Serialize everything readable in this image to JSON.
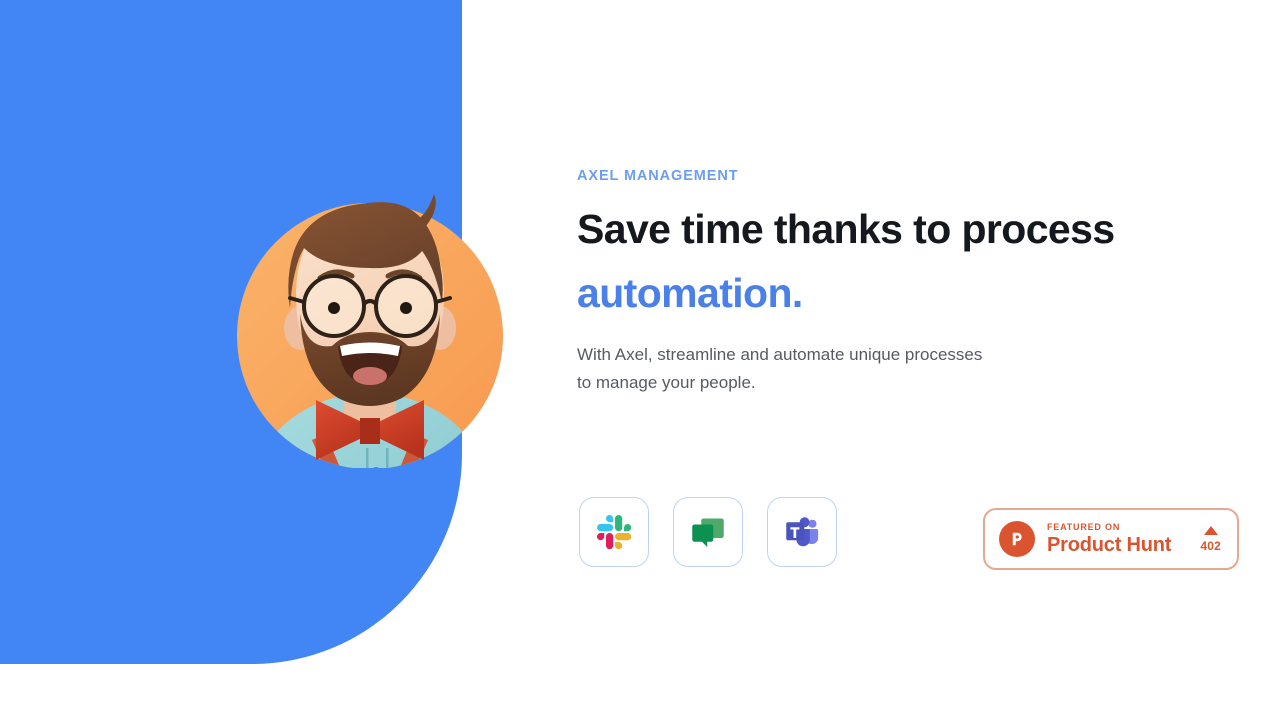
{
  "theme": {
    "panel_blue": "#4285F4",
    "accent_blue": "#4A80E8",
    "eyebrow_blue": "#6D9DEE",
    "heading_dark": "#15191E",
    "body_gray": "#565B62",
    "product_hunt_orange": "#DA552F",
    "card_border_blue": "#BFD4F2",
    "illustration_circle_orange": "#F9A45C"
  },
  "hero": {
    "eyebrow": "AXEL MANAGEMENT",
    "headline_line1": "Save time thanks to process",
    "headline_accent": "automation.",
    "subcopy_line1": "With Axel, streamline and automate unique processes",
    "subcopy_line2": "to manage your people.",
    "illustration_alt": "3D illustration of a bearded man with glasses, red bow tie and suspenders on an orange circle"
  },
  "integrations": [
    {
      "name": "Slack",
      "icon": "slack-icon"
    },
    {
      "name": "Google Chat",
      "icon": "google-chat-icon"
    },
    {
      "name": "Microsoft Teams",
      "icon": "microsoft-teams-icon"
    }
  ],
  "product_hunt": {
    "featured_label": "FEATURED ON",
    "brand": "Product Hunt",
    "upvote_count": "402",
    "logo_letter": "P",
    "upvote_icon": "triangle-up-icon"
  }
}
